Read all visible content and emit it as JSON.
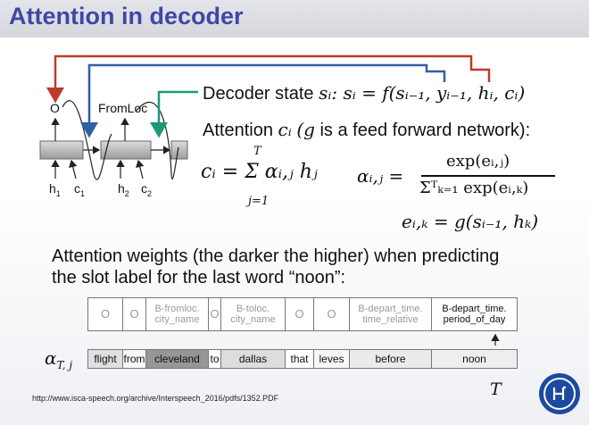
{
  "header": {
    "title": "Attention in decoder"
  },
  "rnn_labels": {
    "out1": "O",
    "out2": "FromLoc",
    "h1": "h",
    "h1_sub": "1",
    "c1": "c",
    "c1_sub": "1",
    "h2": "h",
    "h2_sub": "2",
    "c2": "c",
    "c2_sub": "2"
  },
  "text": {
    "decoder_state_prefix": "Decoder state",
    "decoder_state_formula": "sᵢ: sᵢ = f(sᵢ₋₁, yᵢ₋₁, hᵢ, cᵢ)",
    "attention_prefix": "Attention",
    "attention_ci": "cᵢ",
    "attention_g": "(g",
    "attention_suffix": "is a feed forward network):",
    "formula_c": "cᵢ = Σ αᵢ,ⱼ hⱼ",
    "sum_top": "T",
    "sum_bottom": "j=1",
    "formula_alpha_lhs": "αᵢ,ⱼ =",
    "formula_alpha_num": "exp(eᵢ,ⱼ)",
    "formula_alpha_den": "Σᵀₖ₌₁ exp(eᵢ,ₖ)",
    "formula_e": "eᵢ,ₖ = g(sᵢ₋₁, hₖ)",
    "weights_line1": "Attention weights (the darker the higher) when predicting",
    "weights_line2": "the slot label for the last word “noon”:",
    "alpha_label": "α",
    "alpha_sub": "T, j",
    "t_label": "T",
    "footer_url": "http://www.isca-speech.org/archive/Interspeech_2016/pdfs/1352.PDF"
  },
  "slot_labels": [
    {
      "l1": "O",
      "l2": ""
    },
    {
      "l1": "O",
      "l2": ""
    },
    {
      "l1": "B-fromloc.",
      "l2": "city_name"
    },
    {
      "l1": "O",
      "l2": ""
    },
    {
      "l1": "B-toloc.",
      "l2": "city_name"
    },
    {
      "l1": "O",
      "l2": ""
    },
    {
      "l1": "O",
      "l2": ""
    },
    {
      "l1": "B-depart_time.",
      "l2": "time_relative"
    },
    {
      "l1": "B-depart_time.",
      "l2": "period_of_day"
    }
  ],
  "tokens": [
    {
      "word": "flight",
      "weight": 0.18
    },
    {
      "word": "from",
      "weight": 0.05
    },
    {
      "word": "cleveland",
      "weight": 0.62
    },
    {
      "word": "to",
      "weight": 0.0
    },
    {
      "word": "dallas",
      "weight": 0.2
    },
    {
      "word": "that",
      "weight": 0.0
    },
    {
      "word": "leves",
      "weight": 0.05
    },
    {
      "word": "before",
      "weight": 0.12
    },
    {
      "word": "noon",
      "weight": 0.1
    }
  ],
  "colors": {
    "title": "#3f47a6",
    "red_arrow": "#c0392b",
    "blue_arrow": "#2f5fa8",
    "green_arrow": "#1a9a7a",
    "logo": "#1c4aa0"
  }
}
